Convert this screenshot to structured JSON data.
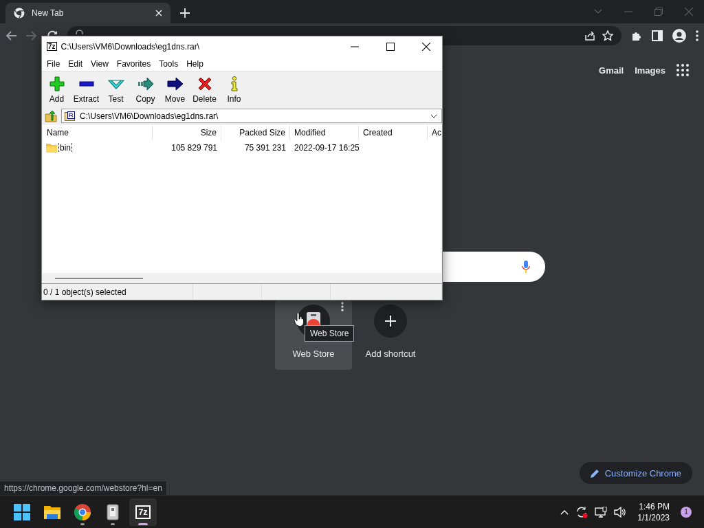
{
  "browser": {
    "tabs": [
      {
        "title": "New Tab",
        "selected": true
      }
    ],
    "header_links": [
      "Gmail",
      "Images"
    ],
    "shortcuts": [
      {
        "title": "Web Store",
        "kind": "site",
        "hovered": true
      },
      {
        "title": "Add shortcut",
        "kind": "add",
        "hovered": false
      }
    ],
    "tooltip": "Web Store",
    "customize_button": "Customize Chrome",
    "status_url": "https://chrome.google.com/webstore?hl=en"
  },
  "archive_window": {
    "icon_label": "7z",
    "title": "C:\\Users\\VM6\\Downloads\\eg1dns.rar\\",
    "menu": [
      "File",
      "Edit",
      "View",
      "Favorites",
      "Tools",
      "Help"
    ],
    "toolbar": [
      {
        "label": "Add",
        "kind": "add"
      },
      {
        "label": "Extract",
        "kind": "extract"
      },
      {
        "label": "Test",
        "kind": "test"
      },
      {
        "label": "Copy",
        "kind": "copy"
      },
      {
        "label": "Move",
        "kind": "move"
      },
      {
        "label": "Delete",
        "kind": "delete"
      },
      {
        "label": "Info",
        "kind": "info"
      }
    ],
    "path": "C:\\Users\\VM6\\Downloads\\eg1dns.rar\\",
    "columns": [
      "Name",
      "Size",
      "Packed Size",
      "Modified",
      "Created",
      "Ac"
    ],
    "rows": [
      {
        "cells": [
          "bin",
          "105 829 791",
          "75 391 231",
          "2022-09-17 16:25"
        ],
        "kind": "folder",
        "focused": true
      }
    ],
    "status": "0 / 1 object(s) selected"
  },
  "taskbar": {
    "apps": [
      {
        "kind": "start",
        "running": false,
        "selected": false
      },
      {
        "kind": "explorer",
        "running": false,
        "selected": false
      },
      {
        "kind": "chrome",
        "running": true,
        "selected": false
      },
      {
        "kind": "archiver",
        "running": true,
        "selected": false
      },
      {
        "kind": "sevenzip",
        "label": "7z",
        "running": true,
        "selected": true
      }
    ],
    "time": "1:46 PM",
    "date": "1/1/2023",
    "notification_count": "1"
  }
}
